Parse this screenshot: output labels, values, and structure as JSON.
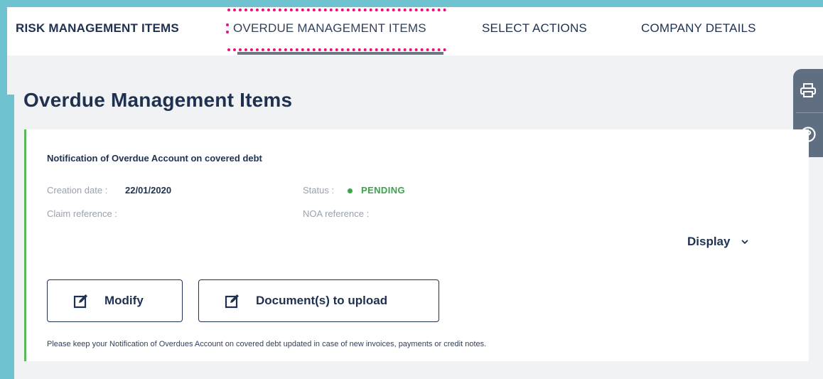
{
  "nav": {
    "tabs": [
      {
        "label": "RISK MANAGEMENT ITEMS"
      },
      {
        "label": "OVERDUE MANAGEMENT ITEMS"
      },
      {
        "label": "SELECT ACTIONS"
      },
      {
        "label": "COMPANY DETAILS"
      }
    ],
    "active_tab_index": 1
  },
  "side_tools": {
    "icons": [
      "print-icon",
      "help-icon"
    ]
  },
  "page": {
    "title": "Overdue Management Items"
  },
  "card": {
    "title": "Notification of Overdue Account on covered debt",
    "creation_date_label": "Creation date :",
    "creation_date_value": "22/01/2020",
    "status_label": "Status :",
    "status_value": "PENDING",
    "claim_reference_label": "Claim reference :",
    "noa_reference_label": "NOA reference :",
    "display_label": "Display",
    "modify_label": "Modify",
    "documents_label": "Document(s) to upload",
    "footnote": "Please keep your Notification of Overdues Account on covered debt updated in case of new invoices, payments or credit notes."
  },
  "colors": {
    "frame": "#6fc3d1",
    "highlight": "#e21381",
    "status_pending": "#3aa54a",
    "card_accent": "#5cb85c",
    "text": "#1e3150"
  }
}
